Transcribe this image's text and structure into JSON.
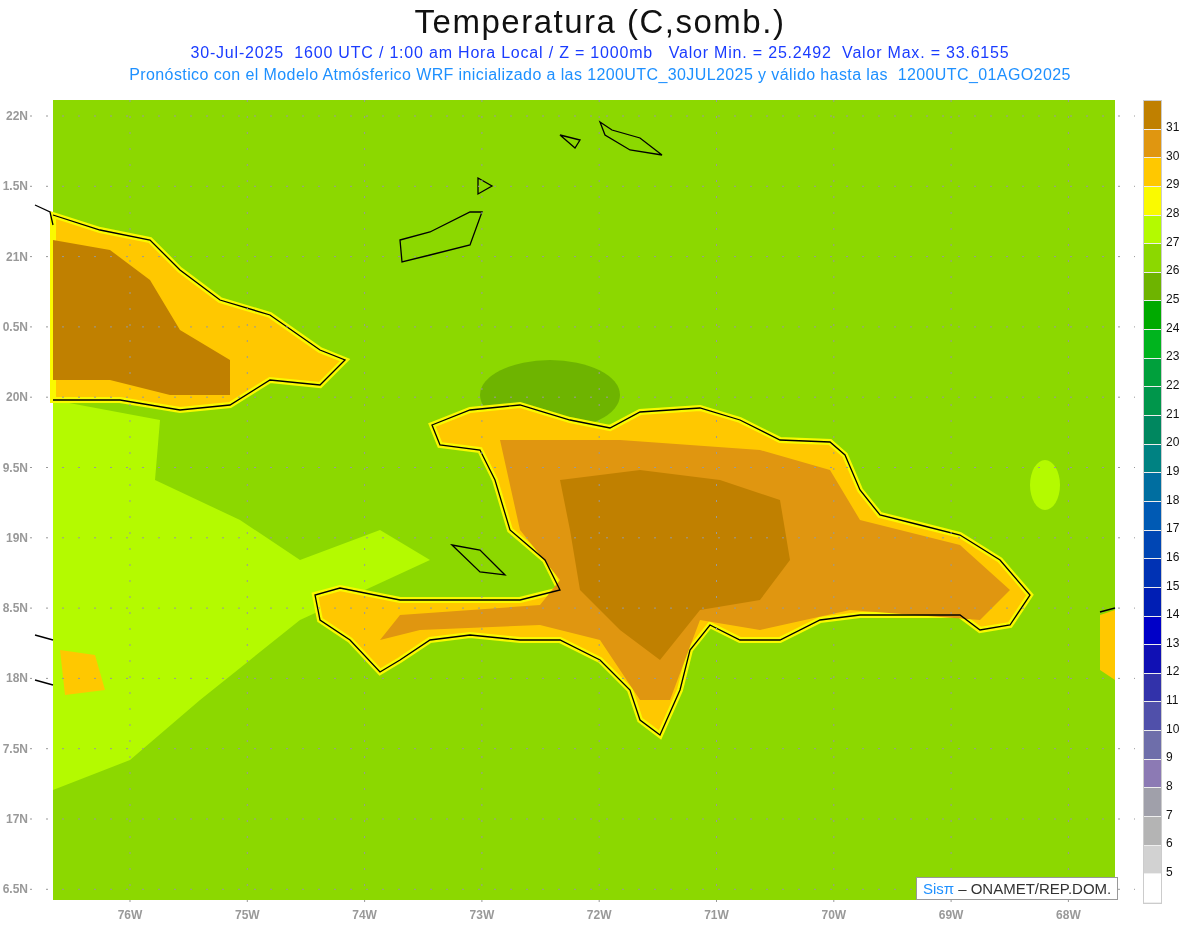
{
  "title": "Temperatura (C,somb.)",
  "subtitle": "30-Jul-2025  1600 UTC / 1:00 am Hora Local / Z = 1000mb   Valor Min. = 25.2492  Valor Max. = 33.6155",
  "note": "Pronóstico con el Modelo Atmósferico WRF inicializado a las 1200UTC_30JUL2025 y válido hasta las  1200UTC_01AGO2025",
  "map": {
    "y_labels": [
      "22N",
      "1.5N",
      "21N",
      "0.5N",
      "20N",
      "9.5N",
      "19N",
      "8.5N",
      "18N",
      "7.5N",
      "17N",
      "6.5N"
    ],
    "x_labels": [
      "76W",
      "75W",
      "74W",
      "73W",
      "72W",
      "71W",
      "70W",
      "69W",
      "68W"
    ]
  },
  "credit": {
    "brand": "Sisπ",
    "text": "– ONAMET/REP.DOM."
  },
  "colorbar": {
    "bins": [
      {
        "color": "#c08000"
      },
      {
        "color": "#e09610"
      },
      {
        "color": "#ffc800"
      },
      {
        "color": "#fafa00"
      },
      {
        "color": "#b4fa00"
      },
      {
        "color": "#8cd800"
      },
      {
        "color": "#6eb400"
      },
      {
        "color": "#00aa00"
      },
      {
        "color": "#00b41e"
      },
      {
        "color": "#00a03c"
      },
      {
        "color": "#00964b"
      },
      {
        "color": "#00875f"
      },
      {
        "color": "#008282"
      },
      {
        "color": "#006ea0"
      },
      {
        "color": "#005ab4"
      },
      {
        "color": "#0046b4"
      },
      {
        "color": "#0032b4"
      },
      {
        "color": "#001eb4"
      },
      {
        "color": "#0000c8"
      },
      {
        "color": "#1010b4"
      },
      {
        "color": "#3232aa"
      },
      {
        "color": "#5050aa"
      },
      {
        "color": "#6e6eaa"
      },
      {
        "color": "#8c7ab4"
      },
      {
        "color": "#a0a0aa"
      },
      {
        "color": "#b4b4b4"
      },
      {
        "color": "#d2d2d2"
      },
      {
        "color": "#ffffff"
      }
    ],
    "labels": [
      "31",
      "30",
      "29",
      "28",
      "27",
      "26",
      "25",
      "24",
      "23",
      "22",
      "21",
      "20",
      "19",
      "18",
      "17",
      "16",
      "15",
      "14",
      "13",
      "12",
      "11",
      "10",
      "9",
      "8",
      "7",
      "6",
      "5"
    ]
  }
}
